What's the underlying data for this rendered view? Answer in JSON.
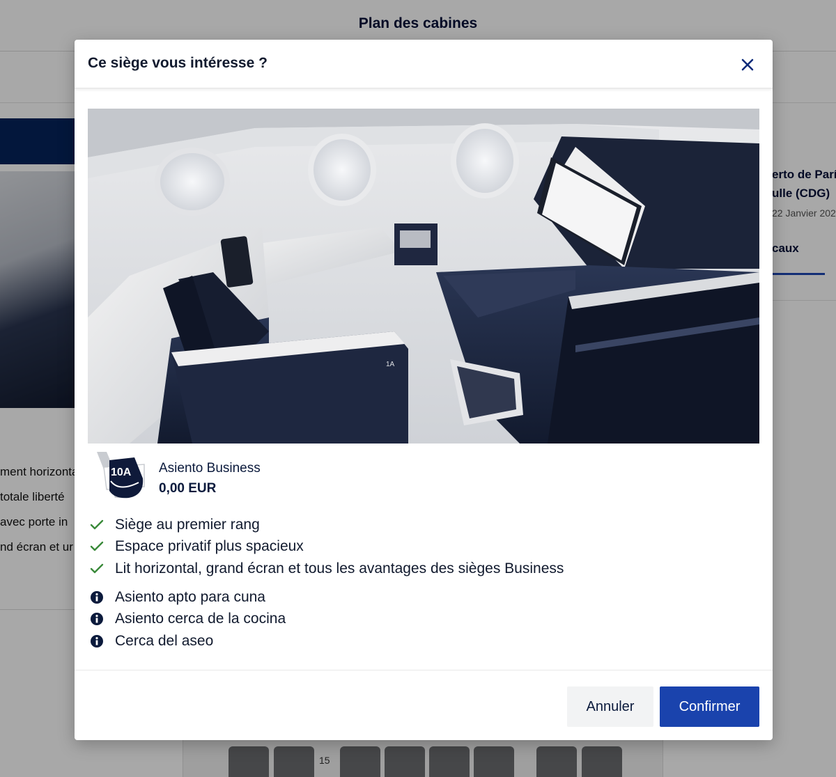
{
  "background": {
    "page_title": "Plan des cabines",
    "left_texts": [
      "ment horizonta",
      "totale liberté",
      "avec porte in",
      "nd écran et ur"
    ],
    "right_route_line1": "erto de Parí",
    "right_route_line2": "ulle (CDG)",
    "right_date": "22 Janvier 202",
    "right_tab": "caux",
    "row_number": "15"
  },
  "modal": {
    "title": "Ce siège vous intéresse ?",
    "close_icon": "close-icon",
    "seat": {
      "number": "10A",
      "type": "Asiento Business",
      "price": "0,00 EUR",
      "photo_seat_label": "1A"
    },
    "features": [
      {
        "icon": "check-icon",
        "text": "Siège au premier rang"
      },
      {
        "icon": "check-icon",
        "text": "Espace privatif plus spacieux"
      },
      {
        "icon": "check-icon",
        "text": "Lit horizontal, grand écran et tous les avantages des sièges Business"
      }
    ],
    "info": [
      {
        "icon": "info-icon",
        "text": "Asiento apto para cuna"
      },
      {
        "icon": "info-icon",
        "text": "Asiento cerca de la cocina"
      },
      {
        "icon": "info-icon",
        "text": "Cerca del aseo"
      }
    ],
    "buttons": {
      "cancel": "Annuler",
      "confirm": "Confirmer"
    }
  },
  "colors": {
    "navy": "#051039",
    "primary_button": "#1a43ad",
    "check": "#3a8a3a",
    "overlay": "rgba(0,0,0,0.34)"
  }
}
